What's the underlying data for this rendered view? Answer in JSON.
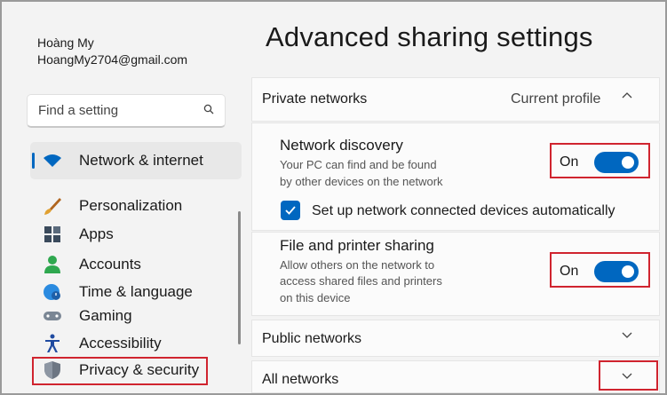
{
  "user": {
    "name": "Hoàng My",
    "email": "HoangMy2704@gmail.com"
  },
  "search": {
    "placeholder": "Find a setting",
    "icon": "search-icon"
  },
  "sidebar": {
    "items": [
      {
        "label": "Network & internet",
        "icon": "wifi-icon",
        "active": true
      },
      {
        "label": "Personalization",
        "icon": "brush-icon"
      },
      {
        "label": "Apps",
        "icon": "apps-icon"
      },
      {
        "label": "Accounts",
        "icon": "person-icon"
      },
      {
        "label": "Time & language",
        "icon": "globe-clock-icon"
      },
      {
        "label": "Gaming",
        "icon": "gamepad-icon"
      },
      {
        "label": "Accessibility",
        "icon": "accessibility-icon"
      },
      {
        "label": "Privacy & security",
        "icon": "shield-icon"
      }
    ]
  },
  "main": {
    "title": "Advanced sharing settings",
    "private": {
      "label": "Private networks",
      "profile": "Current profile",
      "network_discovery": {
        "title": "Network discovery",
        "desc1": "Your PC can find and be found",
        "desc2": "by other devices on the network",
        "state": "On"
      },
      "auto_setup": {
        "label": "Set up network connected devices automatically",
        "checked": true
      },
      "file_sharing": {
        "title": "File and printer sharing",
        "desc1": "Allow others on the network to",
        "desc2": "access shared files and printers",
        "desc3": "on this device",
        "state": "On"
      }
    },
    "public": {
      "label": "Public networks"
    },
    "all": {
      "label": "All networks"
    }
  },
  "colors": {
    "accent": "#0067c0",
    "highlight": "#d0242f"
  }
}
